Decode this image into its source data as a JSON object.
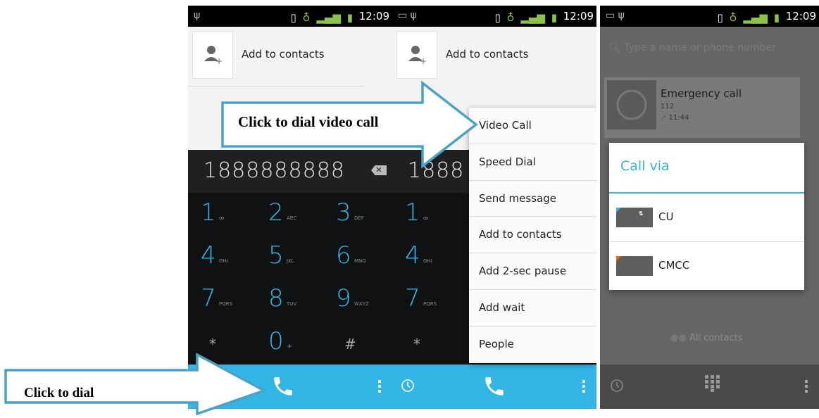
{
  "status_bar": {
    "time": "12:09"
  },
  "contact_card": {
    "label": "Add to contacts"
  },
  "dialer": {
    "number": "1888888888",
    "number_partial": "1888",
    "keys": [
      {
        "digit": "1",
        "letters": "ꝏ"
      },
      {
        "digit": "2",
        "letters": "ABC"
      },
      {
        "digit": "3",
        "letters": "DEF"
      },
      {
        "digit": "4",
        "letters": "GHI"
      },
      {
        "digit": "5",
        "letters": "JKL"
      },
      {
        "digit": "6",
        "letters": "MNO"
      },
      {
        "digit": "7",
        "letters": "PQRS"
      },
      {
        "digit": "8",
        "letters": "TUV"
      },
      {
        "digit": "9",
        "letters": "WXYZ"
      },
      {
        "digit": "*",
        "letters": ""
      },
      {
        "digit": "0",
        "letters": "+"
      },
      {
        "digit": "#",
        "letters": ""
      }
    ]
  },
  "menu": {
    "items": [
      "Video Call",
      "Speed Dial",
      "Send message",
      "Add to contacts",
      "Add 2-sec pause",
      "Add wait",
      "People"
    ]
  },
  "call_log": {
    "search_placeholder": "Type a name or phone number",
    "recent": {
      "name": "Emergency call",
      "number": "112",
      "time": "11:44"
    },
    "all_contacts": "All contacts"
  },
  "call_via_dialog": {
    "title": "Call via",
    "options": [
      "CU",
      "CMCC"
    ]
  },
  "annotations": {
    "video_call": "Click to dial video call",
    "dial": "Click to dial"
  },
  "colors": {
    "accent": "#33b5e5",
    "callout_arrow": "#4aa3c7"
  }
}
